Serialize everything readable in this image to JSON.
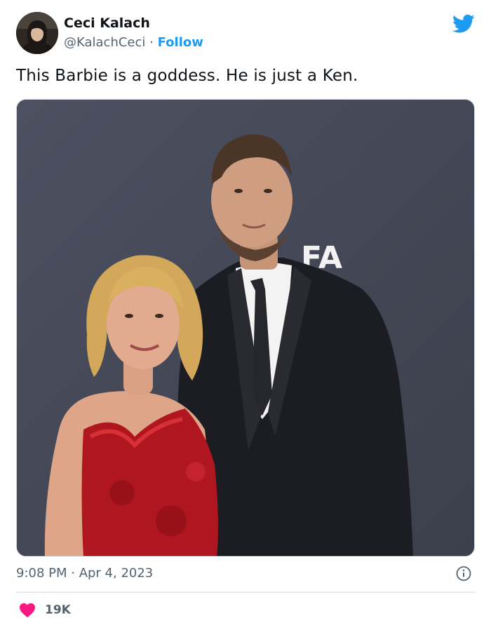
{
  "author": {
    "display_name": "Ceci Kalach",
    "handle": "@KalachCeci",
    "separator": "·",
    "follow_label": "Follow",
    "avatar_icon": "profile-photo"
  },
  "brand": {
    "icon": "twitter-bird-icon",
    "color": "#1d9bf0"
  },
  "tweet": {
    "text": "This Barbie is a goddess. He is just a Ken.",
    "image": {
      "description_icon": "photo",
      "background_logo_text": "FA"
    }
  },
  "meta": {
    "timestamp": "9:08 PM · Apr 4, 2023",
    "info_icon": "info-icon"
  },
  "actions": {
    "like_icon": "heart-icon",
    "like_color": "#f91880",
    "like_count": "19K"
  },
  "colors": {
    "text": "#0f1419",
    "secondary": "#536471",
    "accent": "#1d9bf0",
    "border": "#cfd9de"
  }
}
